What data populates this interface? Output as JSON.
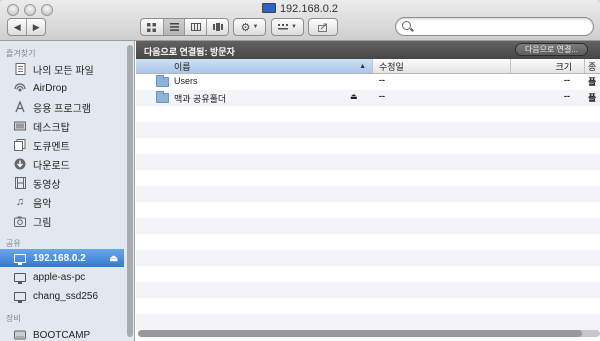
{
  "window": {
    "title": "192.168.0.2"
  },
  "toolbar": {
    "back_icon": "chevron-left-icon",
    "forward_icon": "chevron-right-icon",
    "view_icons": [
      "icon-view-icon",
      "list-view-icon",
      "column-view-icon",
      "coverflow-view-icon"
    ],
    "action_icon": "gear-icon",
    "arrange_icon": "arrange-icon",
    "share_icon": "share-icon",
    "search_placeholder": ""
  },
  "sidebar": {
    "favorites_header": "즐겨찾기",
    "favorites": [
      {
        "label": "나의 모든 파일",
        "icon": "all-files-icon"
      },
      {
        "label": "AirDrop",
        "icon": "airdrop-icon"
      },
      {
        "label": "응용 프로그램",
        "icon": "applications-icon"
      },
      {
        "label": "데스크탑",
        "icon": "desktop-icon"
      },
      {
        "label": "도큐멘트",
        "icon": "documents-icon"
      },
      {
        "label": "다운로드",
        "icon": "downloads-icon"
      },
      {
        "label": "동영상",
        "icon": "movies-icon"
      },
      {
        "label": "음악",
        "icon": "music-icon"
      },
      {
        "label": "그림",
        "icon": "pictures-icon"
      }
    ],
    "shared_header": "공유",
    "shared": [
      {
        "label": "192.168.0.2",
        "icon": "monitor-icon",
        "selected": true
      },
      {
        "label": "apple-as-pc",
        "icon": "pc-icon"
      },
      {
        "label": "chang_ssd256",
        "icon": "pc-icon"
      }
    ],
    "devices_header": "장비",
    "devices": [
      {
        "label": "BOOTCAMP",
        "icon": "drive-icon"
      }
    ]
  },
  "pathbar": {
    "text": "다음으로 연결됨: 방문자",
    "connect_button": "다음으로 연결..."
  },
  "columns": {
    "name": "이름",
    "modified": "수정일",
    "size": "크기",
    "kind": "종"
  },
  "files": [
    {
      "name": "Users",
      "modified": "--",
      "size": "--",
      "kind": "폴",
      "eject": false
    },
    {
      "name": "맥과 공유폴더",
      "modified": "--",
      "size": "--",
      "kind": "폴",
      "eject": true
    }
  ],
  "colors": {
    "selection": "#3479d3",
    "sidebar_bg": "#e2e8ef",
    "pathbar_bg": "#4f4f4f"
  }
}
